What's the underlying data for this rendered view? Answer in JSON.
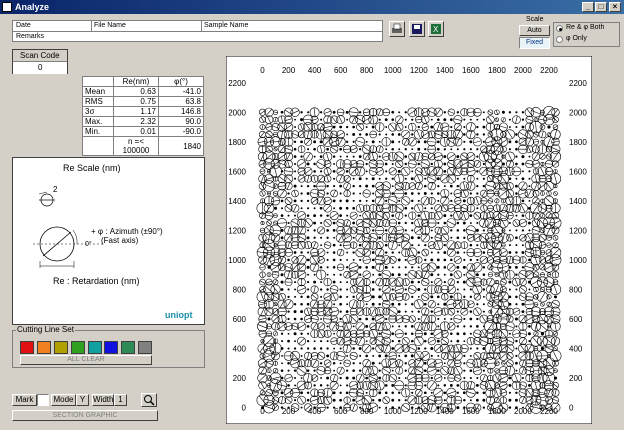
{
  "window": {
    "title": "Analyze",
    "controls": [
      "_",
      "□",
      "×"
    ]
  },
  "info_fields": {
    "date_label": "Date",
    "file_name_label": "File Name",
    "sample_name_label": "Sample Name",
    "remarks_label": "Remarks"
  },
  "toolbar_icons": [
    "printer-icon",
    "save-icon",
    "excel-icon"
  ],
  "scale": {
    "label": "Scale",
    "auto_label": "Auto",
    "fixed_label": "Fixed",
    "selected": "Fixed",
    "option_both": "Re & φ Both",
    "option_phi": "φ Only",
    "selected_option": "Re & φ Both"
  },
  "scan_code": {
    "label": "Scan Code",
    "value": "0"
  },
  "stats": {
    "headers": [
      "Re(nm)",
      "φ(°)"
    ],
    "rows": [
      {
        "label": "Mean",
        "re": "0.63",
        "phi": "-41.0"
      },
      {
        "label": "RMS",
        "re": "0.75",
        "phi": "63.8"
      },
      {
        "label": "3σ",
        "re": "1.17",
        "phi": "146.8"
      },
      {
        "label": "Max.",
        "re": "2.32",
        "phi": "90.0"
      },
      {
        "label": "Min.",
        "re": "0.01",
        "phi": "-90.0"
      }
    ],
    "count_label": "n =< 100000",
    "count_value": "1840"
  },
  "legend": {
    "re_scale": "Re Scale (nm)",
    "scale_value": "2",
    "azimuth_text": "+ φ : Azimuth (±90°)",
    "fast_axis": "(Fast axis)",
    "zero_deg": "0°",
    "retardation": "Re : Retardation (nm)",
    "logo": "uniopt"
  },
  "cutting": {
    "label": "Cutting Line Set",
    "colors": [
      "#e01010",
      "#f08020",
      "#b0a000",
      "#30a020",
      "#10a0a0",
      "#1010e0",
      "#2e8b57",
      "#808080"
    ],
    "all_clear": "ALL CLEAR"
  },
  "mark": {
    "mark_label": "Mark",
    "mode_label": "Mode",
    "mode_value": "Y",
    "width_label": "Width",
    "width_value": "1",
    "section_graphic": "SECTION GRAPHIC"
  },
  "chart_data": {
    "type": "scatter",
    "description_axes": "top and bottom x axes, left and right y axes",
    "x_ticks": [
      0,
      200,
      400,
      600,
      800,
      1000,
      1200,
      1400,
      1600,
      1800,
      2000,
      2200
    ],
    "y_ticks": [
      0,
      200,
      400,
      600,
      800,
      1000,
      1200,
      1400,
      1600,
      1800,
      2000,
      2200
    ],
    "xlim": [
      -50,
      2300
    ],
    "ylim": [
      -30,
      2300
    ],
    "grid_x": {
      "start": 0,
      "end": 2250,
      "step": 50
    },
    "grid_y": {
      "start": 0,
      "end": 2000,
      "step": 50
    }
  }
}
